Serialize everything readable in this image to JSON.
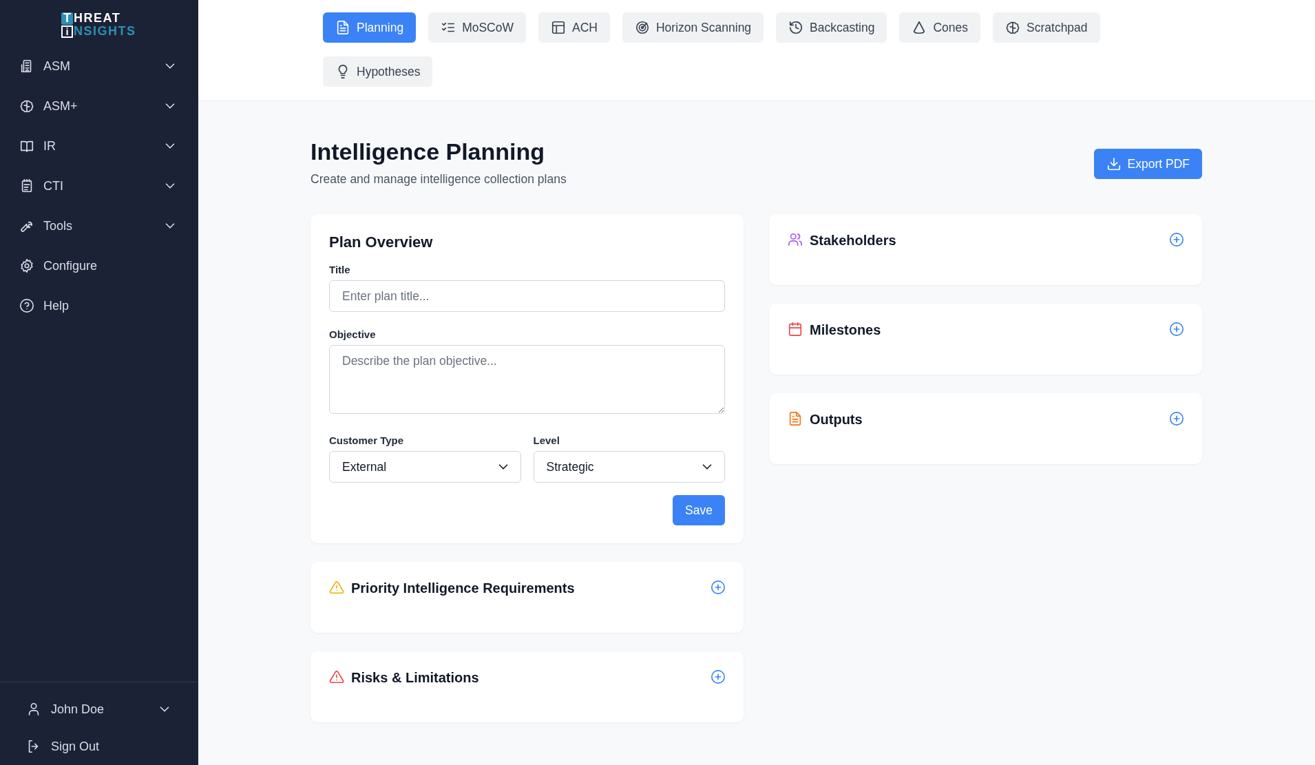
{
  "sidebar": {
    "logo": {
      "line1_initial": "T",
      "line1_rest": "HREAT",
      "line2_initial": "i",
      "line2_rest": "NSIGHTS"
    },
    "items": [
      {
        "label": "ASM",
        "expandable": true
      },
      {
        "label": "ASM+",
        "expandable": true
      },
      {
        "label": "IR",
        "expandable": true
      },
      {
        "label": "CTI",
        "expandable": true
      },
      {
        "label": "Tools",
        "expandable": true
      },
      {
        "label": "Configure",
        "expandable": false
      },
      {
        "label": "Help",
        "expandable": false
      }
    ],
    "user": {
      "name": "John Doe",
      "sign_out": "Sign Out"
    }
  },
  "tabs": [
    {
      "label": "Planning",
      "selected": true
    },
    {
      "label": "MoSCoW",
      "selected": false
    },
    {
      "label": "ACH",
      "selected": false
    },
    {
      "label": "Horizon Scanning",
      "selected": false
    },
    {
      "label": "Backcasting",
      "selected": false
    },
    {
      "label": "Cones",
      "selected": false
    },
    {
      "label": "Scratchpad",
      "selected": false
    },
    {
      "label": "Hypotheses",
      "selected": false
    }
  ],
  "page": {
    "title": "Intelligence Planning",
    "subtitle": "Create and manage intelligence collection plans",
    "export_button": "Export PDF"
  },
  "plan_overview": {
    "heading": "Plan Overview",
    "title_label": "Title",
    "title_placeholder": "Enter plan title...",
    "objective_label": "Objective",
    "objective_placeholder": "Describe the plan objective...",
    "customer_type_label": "Customer Type",
    "customer_type_value": "External",
    "level_label": "Level",
    "level_value": "Strategic",
    "save_button": "Save"
  },
  "left_sections": [
    {
      "title": "Priority Intelligence Requirements",
      "color": "#eab308"
    },
    {
      "title": "Risks & Limitations",
      "color": "#ef4444"
    }
  ],
  "right_sections": [
    {
      "title": "Stakeholders",
      "color": "#a855f7"
    },
    {
      "title": "Milestones",
      "color": "#ef4444"
    },
    {
      "title": "Outputs",
      "color": "#f97316"
    }
  ]
}
